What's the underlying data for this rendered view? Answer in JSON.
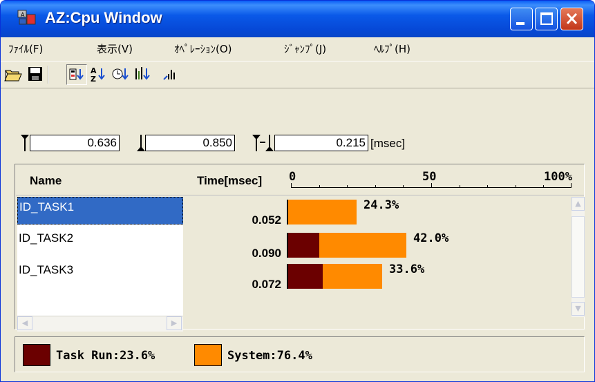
{
  "window": {
    "title": "AZ:Cpu Window",
    "buttons": [
      "minimize",
      "maximize",
      "close"
    ]
  },
  "menu": [
    {
      "label": "ﾌｧｲﾙ(F)"
    },
    {
      "label": "表示(V)"
    },
    {
      "label": "ｵﾍﾟﾚｰｼｮﾝ(O)"
    },
    {
      "label": "ｼﾞｬﾝﾌﾟ(J)"
    },
    {
      "label": "ﾍﾙﾌﾟ(H)"
    }
  ],
  "toolbar": {
    "buttons": [
      {
        "icon": "open-folder-icon"
      },
      {
        "icon": "save-disk-icon"
      },
      {
        "icon": "sort-by-id-icon",
        "pressed": true
      },
      {
        "icon": "sort-by-name-icon"
      },
      {
        "icon": "sort-by-time-icon"
      },
      {
        "icon": "sort-by-bar-icon"
      },
      {
        "icon": "bar-chart-icon"
      }
    ]
  },
  "cursors": {
    "start": "0.636",
    "end": "0.850",
    "delta": "0.215",
    "unit": "[msec]"
  },
  "table": {
    "header_name": "Name",
    "header_time": "Time[msec]",
    "scale_labels": [
      "0",
      "50",
      "100%"
    ],
    "rows": [
      {
        "name": "ID_TASK1",
        "time": "0.052",
        "percent": "24.3%",
        "task_run_pct": 0,
        "total_pct": 24.3,
        "selected": true
      },
      {
        "name": "ID_TASK2",
        "time": "0.090",
        "percent": "42.0%",
        "task_run_pct": 11.2,
        "total_pct": 42.0,
        "selected": false
      },
      {
        "name": "ID_TASK3",
        "time": "0.072",
        "percent": "33.6%",
        "task_run_pct": 12.4,
        "total_pct": 33.6,
        "selected": false
      }
    ]
  },
  "legend": {
    "task_run": {
      "label": "Task Run:23.6%",
      "color": "#6b0000"
    },
    "system": {
      "label": "System:76.4%",
      "color": "#ff8a00"
    }
  }
}
